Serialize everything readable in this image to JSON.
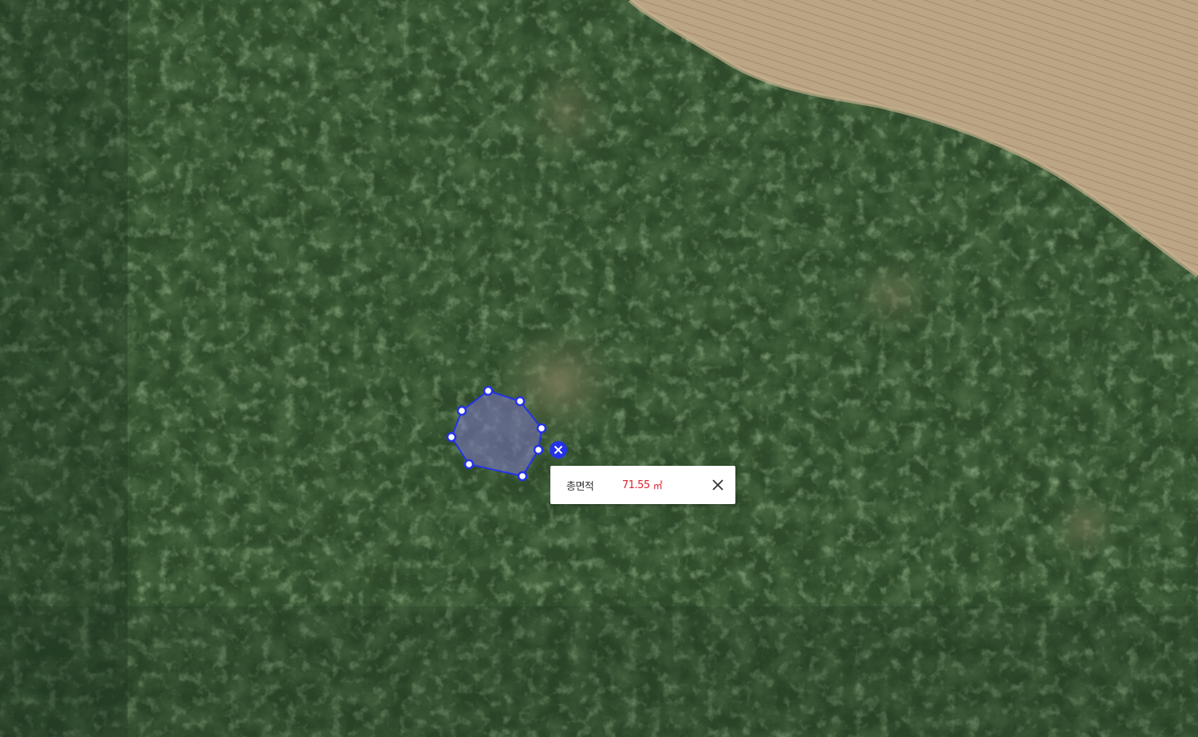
{
  "map": {
    "type": "satellite",
    "colors": {
      "forest_dark": "#1f3a1c",
      "forest": "#34552e",
      "forest_light": "#4d7443",
      "field": "#b9a283",
      "clearing": "#6f7454",
      "polygon_stroke": "#2433e8",
      "polygon_fill": "rgba(128,120,200,0.55)"
    }
  },
  "measure": {
    "tool": "area",
    "vertex_count": 8,
    "delete_icon": "delete-vertex-icon",
    "popup": {
      "label": "총면적",
      "value": "71.55",
      "unit": "㎡",
      "close_icon": "close-icon"
    }
  }
}
